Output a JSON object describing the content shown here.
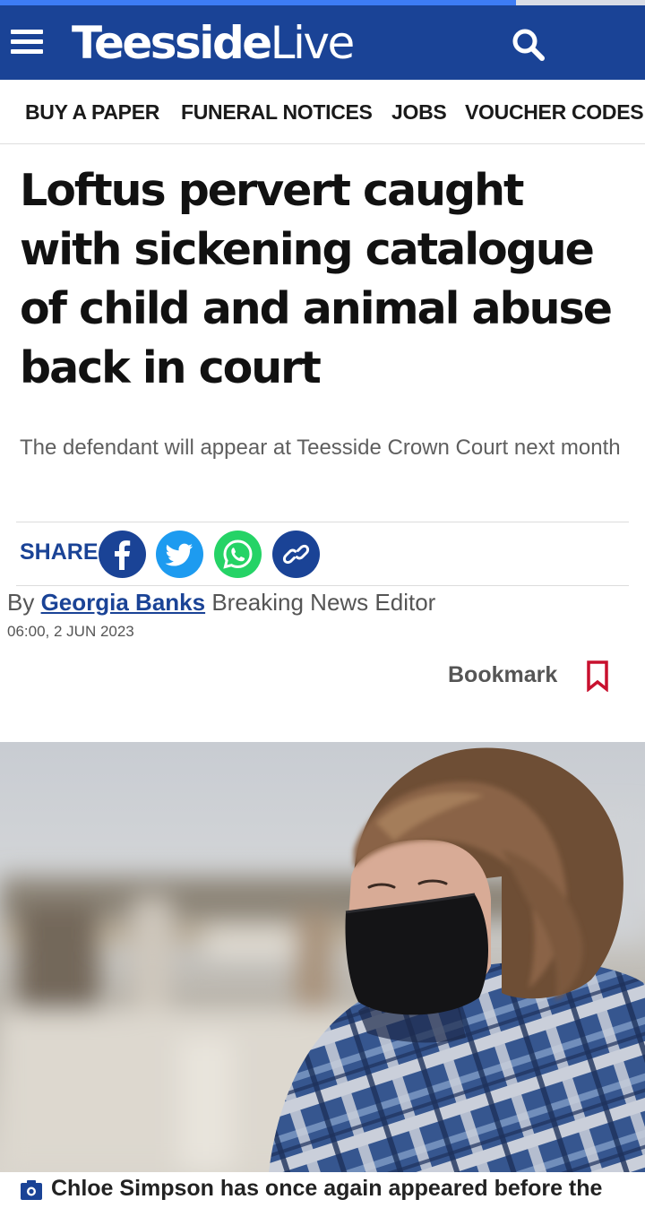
{
  "progress": {
    "fraction": 0.8
  },
  "header": {
    "brand_bold": "Teesside",
    "brand_light": "Live",
    "menu_icon": "hamburger-menu-icon",
    "search_icon": "search-icon",
    "background": "#1a4396"
  },
  "nav": {
    "items": [
      "BUY A PAPER",
      "FUNERAL NOTICES",
      "JOBS",
      "VOUCHER CODES"
    ]
  },
  "article": {
    "headline": "Loftus pervert caught with sickening catalogue of child and animal abuse back in court",
    "standfirst": "The defendant will appear at Teesside Crown Court next month",
    "share": {
      "label": "SHARE",
      "icons": [
        "facebook-icon",
        "twitter-icon",
        "whatsapp-icon",
        "copy-link-icon"
      ],
      "colors": {
        "facebook": "#1a4396",
        "twitter": "#1d9bf0",
        "whatsapp": "#25d366",
        "link": "#1a4396"
      }
    },
    "byline": {
      "prefix": "By",
      "author": "Georgia Banks",
      "role": "Breaking News Editor"
    },
    "timestamp": "06:00, 2 JUN 2023",
    "bookmark_label": "Bookmark",
    "bookmark_color": "#c8102e",
    "caption": "Chloe Simpson has once again appeared before the",
    "caption_icon": "camera-icon"
  }
}
